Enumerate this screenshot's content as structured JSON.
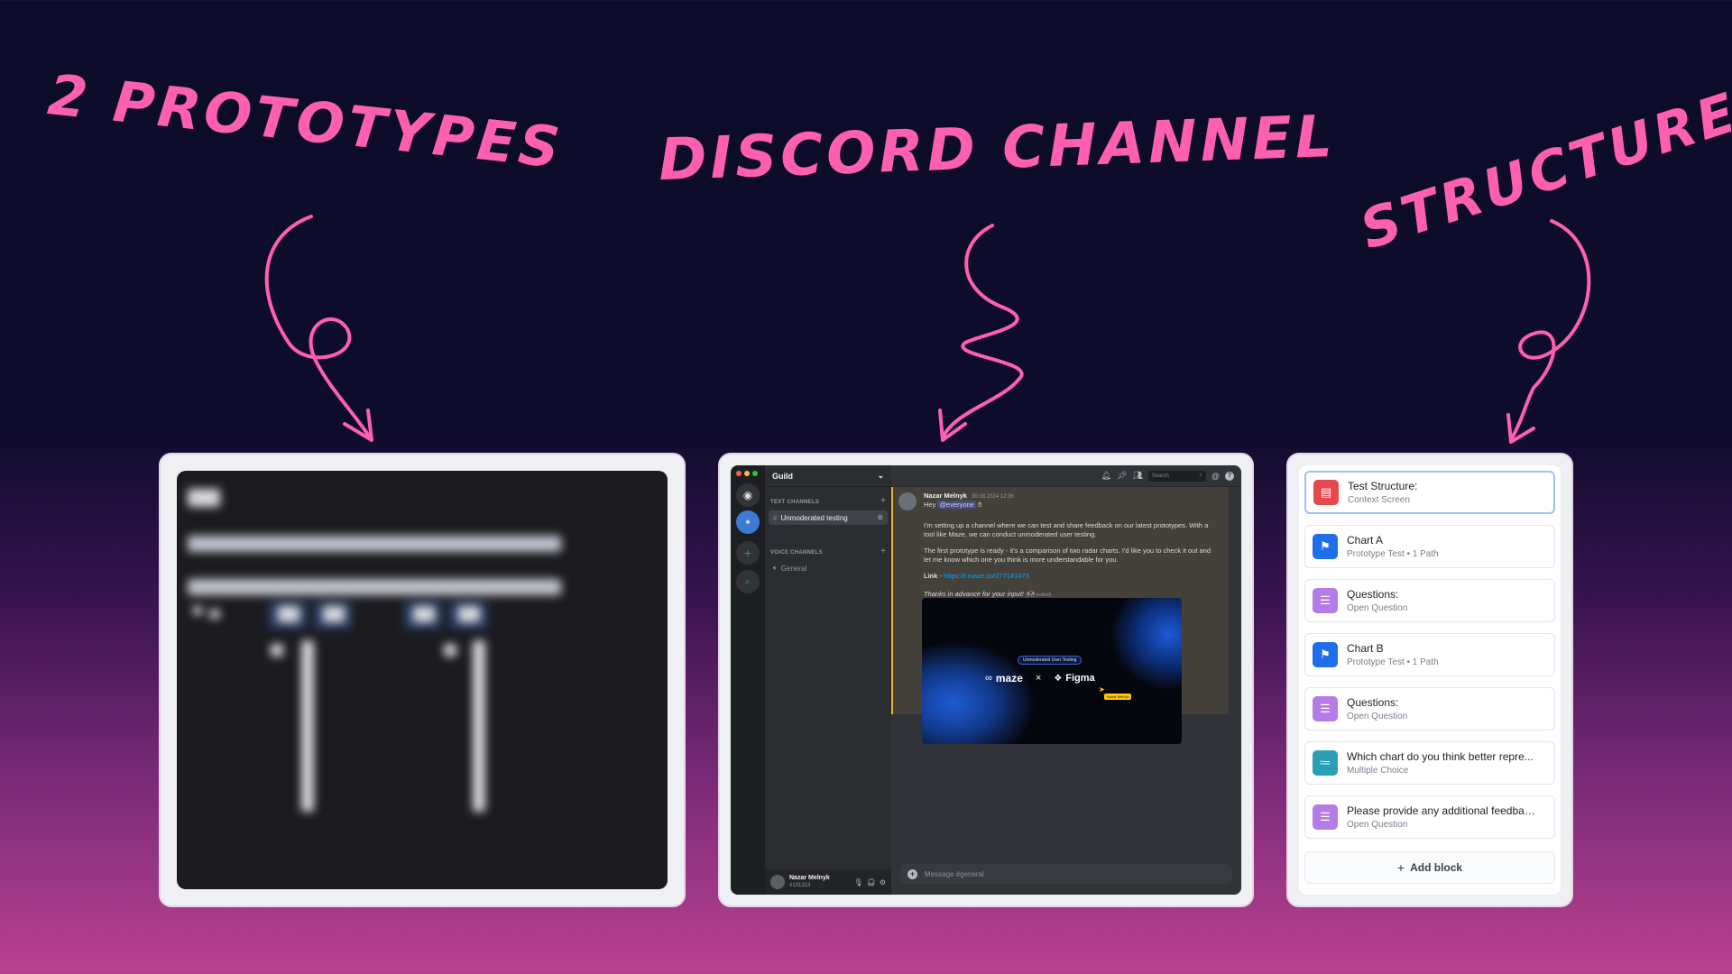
{
  "headings": {
    "prototypes": "2 Prototypes",
    "discord": "Discord Channel",
    "structure": "Structure"
  },
  "colors": {
    "accent": "#ff5fb0",
    "discord_bg": "#313338",
    "mention": "#5865f2"
  },
  "discord": {
    "guild_name": "Guild",
    "text_category": "TEXT CHANNELS",
    "voice_category": "VOICE CHANNELS",
    "text_channel": "Unmoderated testing",
    "voice_channel": "General",
    "user_name": "Nazar Melnyk",
    "user_tag": "#131313",
    "search_placeholder": "Search",
    "message": {
      "author": "Nazar Melnyk",
      "timestamp": "30.08.2024 12:36",
      "greeting_prefix": "Hey",
      "mention": "@everyone",
      "para1": "I'm setting up a channel where we can test and share feedback on our latest prototypes. With a tool like Maze, we can conduct unmoderated user testing.",
      "para2": "The first prototype is ready - it's a comparison of two radar charts. I'd like you to check it out and let me know which one you think is more understandable for you.",
      "link_label": "Link",
      "link_url": "https://t.maze.co/277141473",
      "thanks": "Thanks in advance for your input!",
      "edited": "(edited)"
    },
    "embed": {
      "badge": "Unmoderated User Testing",
      "brand_left": "maze",
      "times": "×",
      "brand_right": "Figma",
      "cursor_label": "Nazar Melnyk"
    },
    "composer_placeholder": "Message #general"
  },
  "structure": {
    "blocks": [
      {
        "title": "Test Structure:",
        "subtitle": "Context Screen",
        "color": "#e5484d",
        "icon": "context-screen-icon"
      },
      {
        "title": "Chart A",
        "subtitle": "Prototype Test • 1 Path",
        "color": "#1f6feb",
        "icon": "flag-icon"
      },
      {
        "title": "Questions:",
        "subtitle": "Open Question",
        "color": "#b57be6",
        "icon": "open-question-icon"
      },
      {
        "title": "Chart B",
        "subtitle": "Prototype Test • 1 Path",
        "color": "#1f6feb",
        "icon": "flag-icon"
      },
      {
        "title": "Questions:",
        "subtitle": "Open Question",
        "color": "#b57be6",
        "icon": "open-question-icon"
      },
      {
        "title": "Which chart do you think better repre...",
        "subtitle": "Multiple Choice",
        "color": "#2a9fb5",
        "icon": "multiple-choice-icon"
      },
      {
        "title": "Please provide any additional feedbac...",
        "subtitle": "Open Question",
        "color": "#b57be6",
        "icon": "open-question-icon"
      }
    ],
    "add_block": "Add block"
  }
}
